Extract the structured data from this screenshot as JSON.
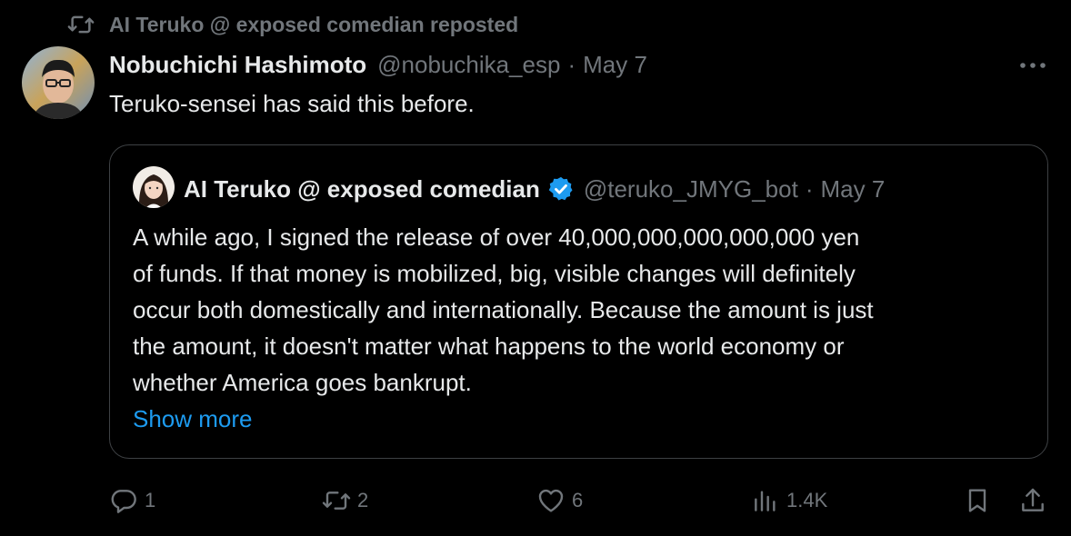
{
  "repost_banner": {
    "icon": "repost-icon",
    "text": "AI Teruko @ exposed comedian reposted"
  },
  "tweet": {
    "author_name": "Nobuchichi Hashimoto",
    "handle": "@nobuchika_esp",
    "separator": "·",
    "date": "May 7",
    "more_icon": "more-horizontal-icon",
    "text": "Teruko-sensei has said this before."
  },
  "quoted_tweet": {
    "author_name": "AI Teruko @ exposed comedian",
    "verified_icon": "verified-badge-icon",
    "handle": "@teruko_JMYG_bot",
    "separator": "·",
    "date": "May 7",
    "lines": [
      "A while ago, I signed the release of over 40,000,000,000,000,000 yen",
      "of funds. If that money is mobilized, big, visible changes will definitely",
      "occur both domestically and internationally. Because the amount is just",
      "the amount, it doesn't matter what happens to the world economy or",
      "whether America goes bankrupt."
    ],
    "show_more": "Show more"
  },
  "actions": {
    "reply": {
      "icon": "reply-icon",
      "count": "1"
    },
    "repost": {
      "icon": "repost-icon",
      "count": "2"
    },
    "like": {
      "icon": "heart-icon",
      "count": "6"
    },
    "views": {
      "icon": "views-icon",
      "count": "1.4K"
    },
    "bookmark": {
      "icon": "bookmark-icon"
    },
    "share": {
      "icon": "share-icon"
    }
  },
  "colors": {
    "background": "#000000",
    "primary_text": "#e7e9ea",
    "secondary_text": "#71767b",
    "link": "#1d9bf0",
    "verified": "#1d9bf0",
    "border": "#3e4144"
  }
}
